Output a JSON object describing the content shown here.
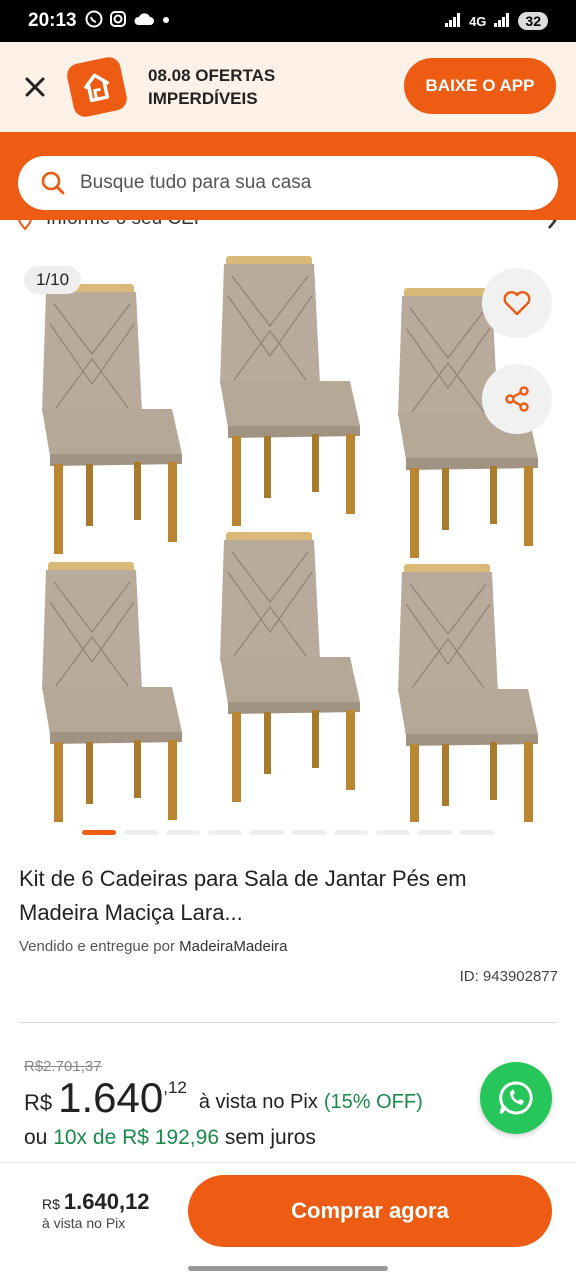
{
  "status": {
    "time": "20:13",
    "network": "4G",
    "battery": "32",
    "colors": {
      "bg": "#000000",
      "text": "#ffffff"
    },
    "icons": [
      "whatsapp-icon",
      "instagram-icon",
      "cloud-icon",
      "dot-icon",
      "signal-icon"
    ]
  },
  "promo": {
    "title_line1": "08.08 OFERTAS",
    "title_line2": "IMPERDÍVEIS",
    "app_button": "BAIXE O APP"
  },
  "search": {
    "placeholder": "Busque tudo para sua casa"
  },
  "cep": {
    "label": "Informe o seu CEP"
  },
  "gallery": {
    "counter": "1/10",
    "total_slides": 10,
    "active_slide": 1
  },
  "product": {
    "title": "Kit de 6 Cadeiras para Sala de Jantar Pés em Madeira Maciça Lara...",
    "seller_prefix": "Vendido e entregue por",
    "seller_name": "MadeiraMadeira",
    "id": "ID: 943902877"
  },
  "price": {
    "old": "R$2.701,37",
    "currency": "R$",
    "integer": "1.640",
    "cents": ",12",
    "pix_text": "à vista no Pix",
    "discount": "(15% OFF)",
    "installments_prefix": "ou",
    "installments_value": "10x de R$ 192,96",
    "installments_suffix": "sem juros"
  },
  "bottom_bar": {
    "currency": "R$",
    "value": "1.640,12",
    "sub": "à vista no Pix",
    "buy_label": "Comprar agora"
  },
  "colors": {
    "accent": "#ee5b12",
    "promo_bg": "#fdf1e8",
    "discount_green": "#1a8a4a",
    "whatsapp": "#27c65a"
  }
}
